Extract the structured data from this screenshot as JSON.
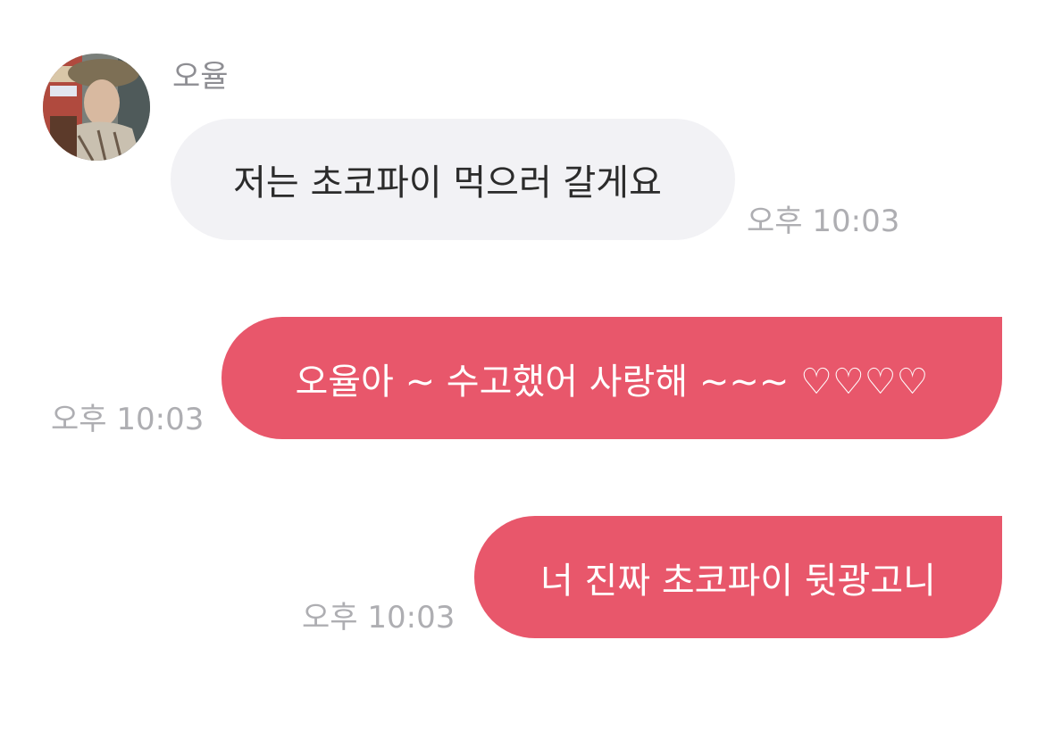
{
  "chat": {
    "sender_name": "오율",
    "avatar": {
      "icon": "profile-photo-avatar"
    },
    "messages": [
      {
        "direction": "incoming",
        "text": "저는 초코파이 먹으러 갈게요",
        "time": "오후 10:03"
      },
      {
        "direction": "outgoing",
        "text": "오율아 ~ 수고했어 사랑해 ~~~ ♡♡♡♡",
        "time": "오후 10:03"
      },
      {
        "direction": "outgoing",
        "text": "너 진짜 초코파이 뒷광고니",
        "time": "오후 10:03"
      }
    ]
  },
  "colors": {
    "incoming_bubble": "#f2f2f5",
    "outgoing_bubble": "#e8576b",
    "timestamp": "#aeaeb2",
    "sender_name": "#8e8e93"
  }
}
